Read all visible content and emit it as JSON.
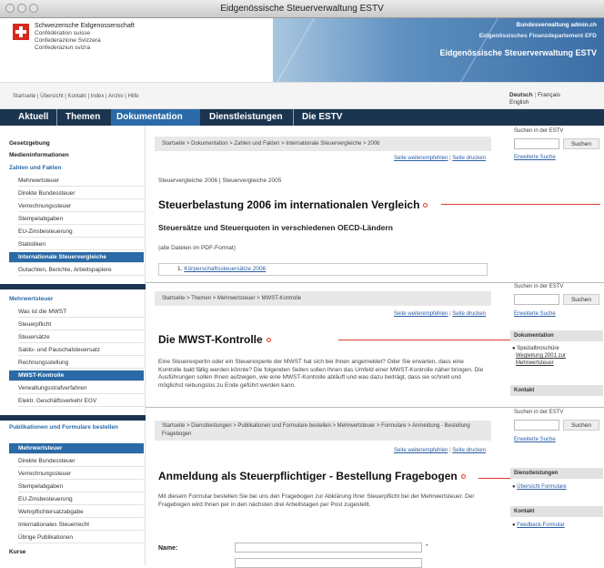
{
  "window": {
    "title": "Eidgenössische Steuerverwaltung ESTV"
  },
  "header": {
    "confed_lines": [
      "Schweizerische Eidgenossenschaft",
      "Confédération suisse",
      "Confederazione Svizzera",
      "Confederaziun svizra"
    ],
    "banner_top": "Bundesverwaltung admin.ch",
    "banner_dept": "Eidgenössisches Finanzdepartement EFD",
    "banner_name": "Eidgenössische Steuerverwaltung ESTV"
  },
  "util": {
    "links": "Startseite | Übersicht | Kontakt | Index | Archiv | Hilfe",
    "lang_de": "Deutsch",
    "lang_fr": "Français",
    "lang_en": "English"
  },
  "nav": [
    "Aktuell",
    "Themen",
    "Dokumentation",
    "Dienstleistungen",
    "Die ESTV"
  ],
  "sidebar": {
    "block1": [
      "Gesetzgebung",
      "Medieninformationen",
      "Zahlen und Fakten",
      "Mehrwertsteuer",
      "Direkte Bundessteuer",
      "Verrechnungssteuer",
      "Stempelabgaben",
      "EU-Zinsbesteuerung",
      "Statistiken",
      "Internationale Steuervergleiche",
      "Gutachten, Berichte, Arbeitspapiere"
    ],
    "block2": [
      "Mehrwertsteuer",
      "Was ist die MWST",
      "Steuerpflicht",
      "Steuersätze",
      "Saldo- und Pauschalsteuersatz",
      "Rechnungsstellung",
      "MWST-Kontrolle",
      "Verwaltungsstrafverfahren",
      "Elektr. Geschäftsverkehr EGV"
    ],
    "block3": [
      "Publikationen und Formulare bestellen",
      "Mehrwertsteuer",
      "Direkte Bundessteuer",
      "Verrechnungssteuer",
      "Stempelabgaben",
      "EU-Zinsbesteuerung",
      "Wehrpflichtersatzabgabe",
      "Internationales Steuerrecht",
      "Übrige Publikationen",
      "Kurse"
    ]
  },
  "section1": {
    "breadcrumb": "Startseite > Dokumentation > Zahlen und Fakten > Internationale Steuervergleiche > 2006",
    "recommend": "Seite weiterempfehlen",
    "print": "Seite drucken",
    "tabs": "Steuervergleiche 2006 | Steuervergleiche 2005",
    "title": "Steuerbelastung 2006 im internationalen Vergleich",
    "subtitle": "Steuersätze und Steuerquoten in verschiedenen OECD-Ländern",
    "note": "(alle Dateien im PDF-Format)",
    "file_num": "1.",
    "file_link": "Körperschaftssteuersätze 2006"
  },
  "section2": {
    "breadcrumb": "Startseite > Themen > Mehrwertsteuer > MWST-Kontrolle",
    "recommend": "Seite weiterempfehlen",
    "print": "Seite drucken",
    "title": "Die MWST-Kontrolle",
    "body": "Eine Steuerexpertin oder ein Steuerexperte der MWST hat sich bei Ihnen angemeldet? Oder Sie erwarten, dass eine Kontrolle bald fällig werden könnte? Die folgenden Seiten sollen Ihnen das Umfeld einer MWST-Kontrolle näher bringen. Die Ausführungen sollen Ihnen aufzeigen, wie eine MWST-Kontrolle abläuft und was dazu beiträgt, dass sie schnell und möglichst reibungslos zu Ende geführt werden kann."
  },
  "section3": {
    "breadcrumb": "Startseite > Dienstleistungen > Publikationen und Formulare bestellen > Mehrwertsteuer > Formulare > Anmeldung - Bestellung Fragebogen",
    "recommend": "Seite weiterempfehlen",
    "print": "Seite drucken",
    "title": "Anmeldung als Steuerpflichtiger - Bestellung Fragebogen",
    "body": "Mit diesem Formular bestellen Sie bei uns den Fragebogen zur Abklärung Ihrer Steuerpflicht bei der Mehrwertsteuer. Der Fragebogen wird Ihnen per in den nächsten drei Arbeitstagen per Post zugestellt.",
    "name_label": "Name:",
    "required": "*"
  },
  "right": {
    "search_label": "Suchen in der ESTV",
    "search_btn": "Suchen",
    "advanced": "Erweiterte Suche",
    "doku_title": "Dokumentation",
    "doku_bullet": "Spezialbroschüre",
    "doku_link": "Wegleitung 2001 zur Mehrwertsteuer",
    "kontakt": "Kontakt",
    "dienst_title": "Dienstleistungen",
    "dienst_link": "Übersicht Formulare",
    "kontakt2": "Kontakt",
    "feedback": "Feedback-Formular"
  },
  "colors": {
    "nav_bg": "#1b3550",
    "accent": "#2a6aa7",
    "marker": "#e03a2a"
  }
}
